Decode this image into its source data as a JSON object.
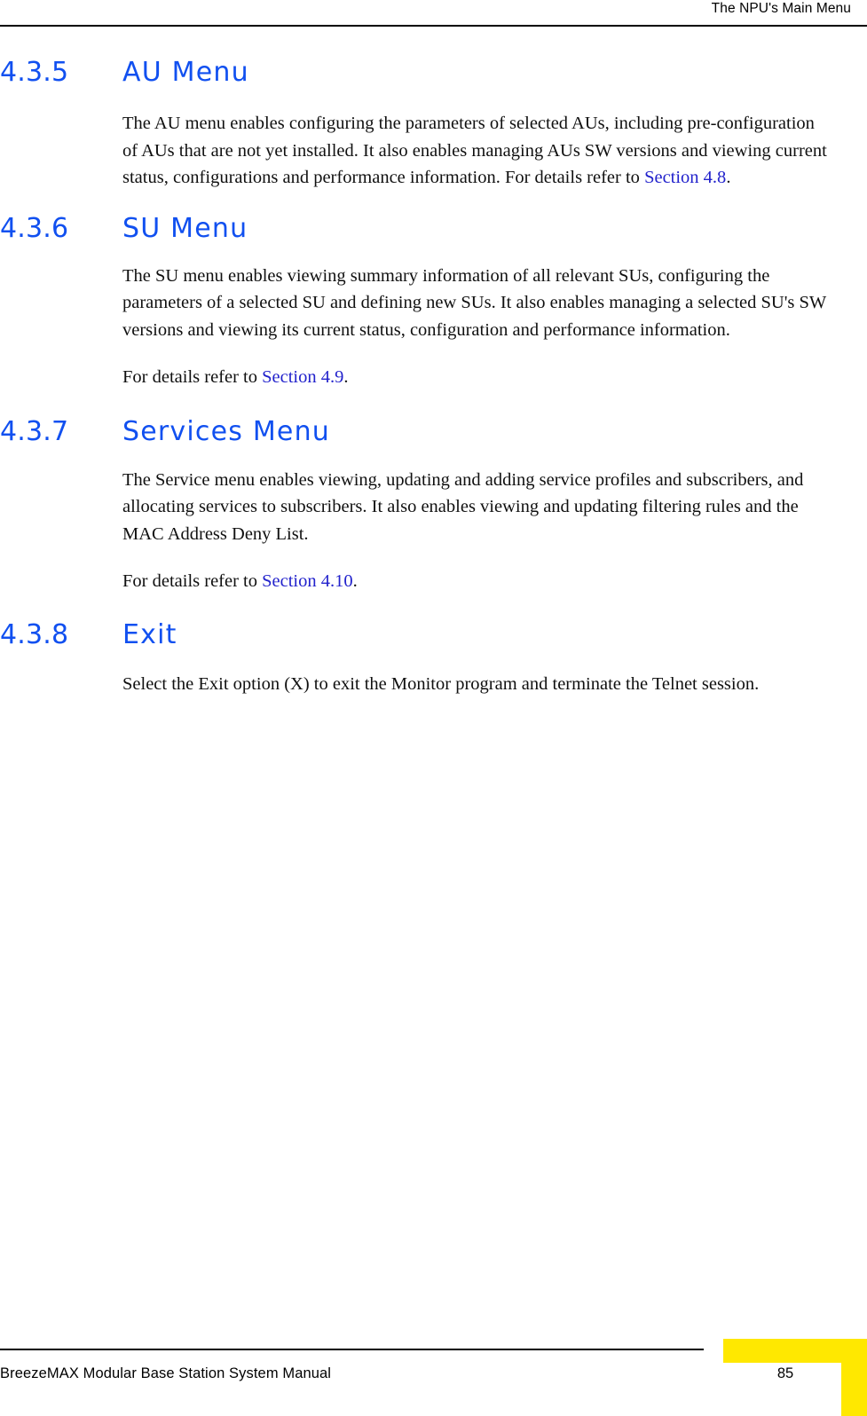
{
  "header": {
    "running_title": "The NPU's Main Menu"
  },
  "sections": [
    {
      "number": "4.3.5",
      "title": "AU Menu",
      "paragraphs": [
        {
          "parts": [
            {
              "type": "text",
              "text": "The AU menu enables configuring the parameters of selected AUs, including pre-configuration of AUs that are not yet installed. It also enables managing AUs SW versions and viewing current status, configurations and performance information. For details refer to "
            },
            {
              "type": "xref",
              "text": "Section 4.8"
            },
            {
              "type": "text",
              "text": "."
            }
          ]
        }
      ]
    },
    {
      "number": "4.3.6",
      "title": "SU Menu",
      "paragraphs": [
        {
          "parts": [
            {
              "type": "text",
              "text": "The SU menu enables viewing summary information of all relevant SUs, configuring the parameters of a selected SU and defining new SUs. It also enables managing a selected SU's SW versions and viewing its current status, configuration and performance information."
            }
          ]
        },
        {
          "parts": [
            {
              "type": "text",
              "text": "For details refer to "
            },
            {
              "type": "xref",
              "text": "Section 4.9"
            },
            {
              "type": "text",
              "text": "."
            }
          ]
        }
      ]
    },
    {
      "number": "4.3.7",
      "title": "Services Menu",
      "paragraphs": [
        {
          "parts": [
            {
              "type": "text",
              "text": "The Service menu enables viewing, updating and adding service profiles and subscribers, and allocating services to subscribers. It also enables viewing and updating filtering rules and the MAC Address Deny List."
            }
          ]
        },
        {
          "parts": [
            {
              "type": "text",
              "text": "For details refer to "
            },
            {
              "type": "xref",
              "text": "Section 4.10"
            },
            {
              "type": "text",
              "text": "."
            }
          ]
        }
      ]
    },
    {
      "number": "4.3.8",
      "title": "Exit",
      "paragraphs": [
        {
          "parts": [
            {
              "type": "text",
              "text": "Select the Exit option (X) to exit the Monitor program and terminate the Telnet session."
            }
          ]
        }
      ]
    }
  ],
  "footer": {
    "manual_title": "BreezeMAX Modular Base Station System Manual",
    "page_number": "85"
  },
  "colors": {
    "heading_blue": "#1150f0",
    "xref_blue": "#2222cc",
    "tab_yellow": "#ffe800",
    "rule_black": "#000000"
  }
}
